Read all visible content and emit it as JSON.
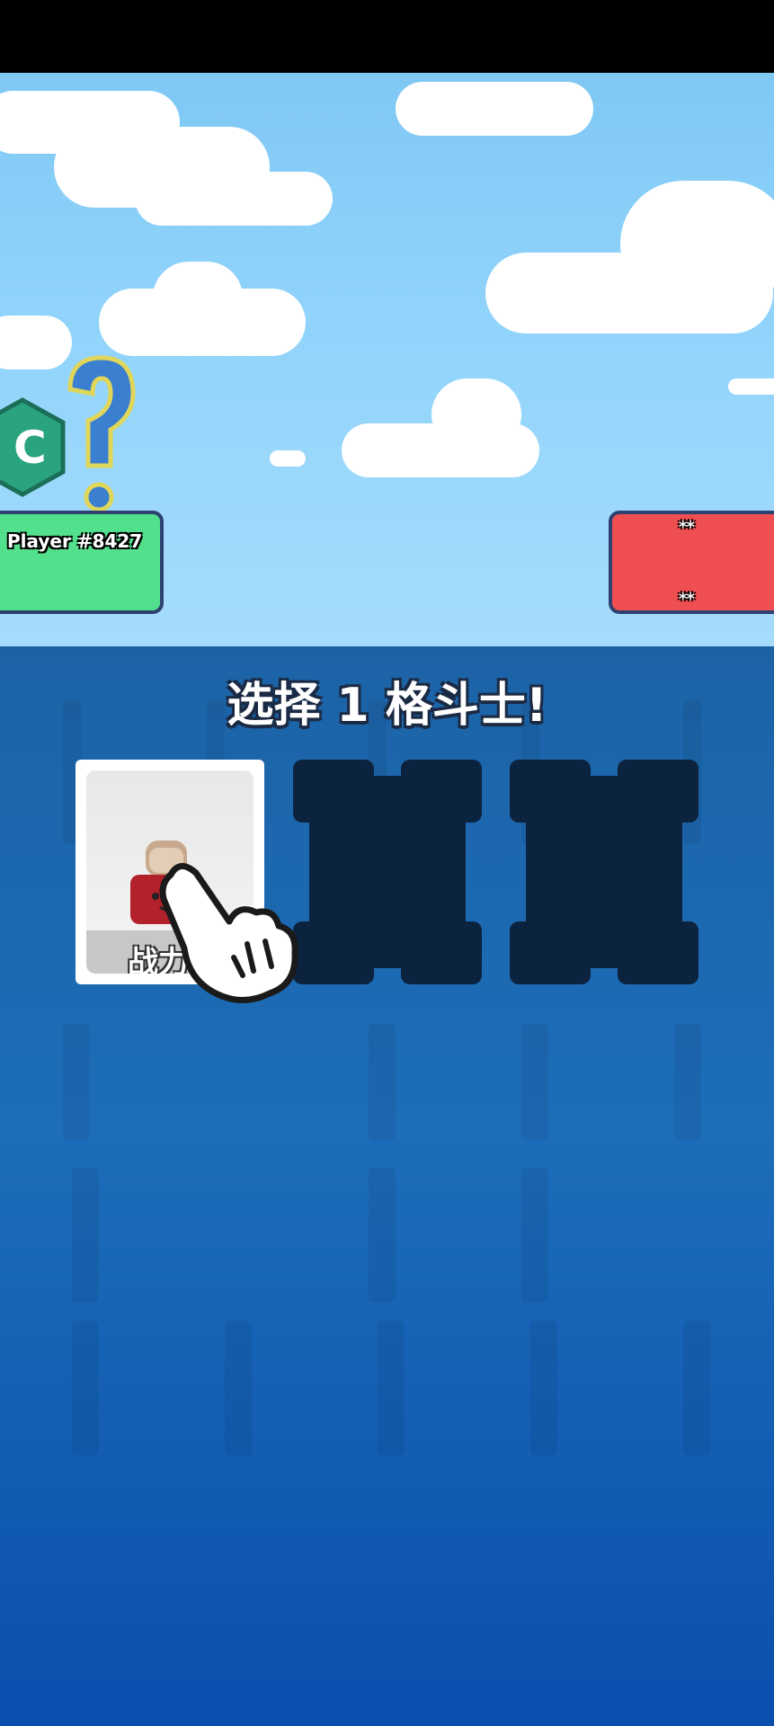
{
  "player": {
    "name": "Player #8427",
    "badge_letter": "C"
  },
  "opponent": {
    "stars_top": "**",
    "stars_bottom": "**"
  },
  "title": "选择 1 格斗士!",
  "fighters": [
    {
      "state": "selected",
      "power_label": "战力 1",
      "icon": "toast-fighter-icon"
    },
    {
      "state": "hidden"
    },
    {
      "state": "hidden"
    }
  ],
  "colors": {
    "player": "#52e08d",
    "opponent": "#f04f52",
    "board": "#1d6db9",
    "slot": "#0c2340"
  },
  "hint_icon": "pointing-hand-icon"
}
